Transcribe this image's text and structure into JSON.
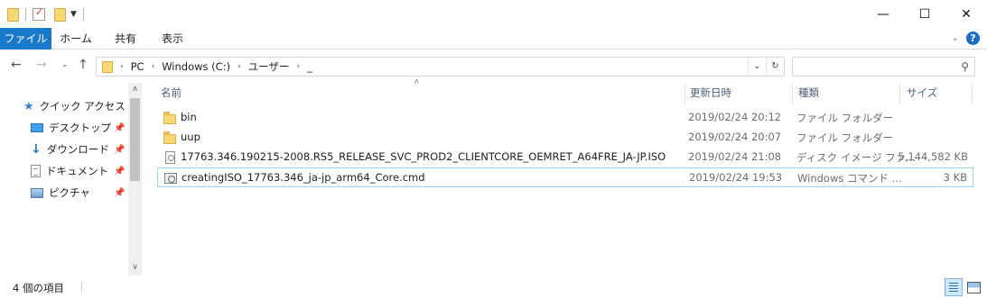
{
  "window": {
    "minimize_glyph": "—",
    "maximize_glyph": "☐",
    "close_glyph": "✕"
  },
  "ribbon": {
    "tabs": [
      "ファイル",
      "ホーム",
      "共有",
      "表示"
    ],
    "accent": "#1979ca",
    "help_glyph": "?",
    "collapse_glyph": "⌄"
  },
  "address": {
    "crumbs": [
      "PC",
      "Windows (C:)",
      "ユーザー",
      "_"
    ],
    "search_placeholder": ""
  },
  "nav_pane": {
    "items": [
      {
        "label": "クイック アクセス",
        "icon": "star-icon"
      },
      {
        "label": "デスクトップ",
        "icon": "desktop-icon",
        "pinned": true
      },
      {
        "label": "ダウンロード",
        "icon": "download-icon",
        "pinned": true
      },
      {
        "label": "ドキュメント",
        "icon": "document-icon",
        "pinned": true
      },
      {
        "label": "ピクチャ",
        "icon": "pictures-icon",
        "pinned": true
      }
    ]
  },
  "file_list": {
    "columns": {
      "name": "名前",
      "date": "更新日時",
      "type": "種類",
      "size": "サイズ"
    },
    "rows": [
      {
        "name": "bin",
        "date": "2019/02/24 20:12",
        "type": "ファイル フォルダー",
        "size": "",
        "icon": "folder-icon",
        "selected": false
      },
      {
        "name": "uup",
        "date": "2019/02/24 20:07",
        "type": "ファイル フォルダー",
        "size": "",
        "icon": "folder-icon",
        "selected": false
      },
      {
        "name": "17763.346.190215-2008.RS5_RELEASE_SVC_PROD2_CLIENTCORE_OEMRET_A64FRE_JA-JP.ISO",
        "date": "2019/02/24 21:08",
        "type": "ディスク イメージ ファ...",
        "size": "5,144,582 KB",
        "icon": "disc-image-icon",
        "selected": false
      },
      {
        "name": "creatingISO_17763.346_ja-jp_arm64_Core.cmd",
        "date": "2019/02/24 19:53",
        "type": "Windows コマンド ...",
        "size": "3 KB",
        "icon": "cmd-script-icon",
        "selected": true
      }
    ]
  },
  "status_bar": {
    "item_count": "4 個の項目"
  }
}
